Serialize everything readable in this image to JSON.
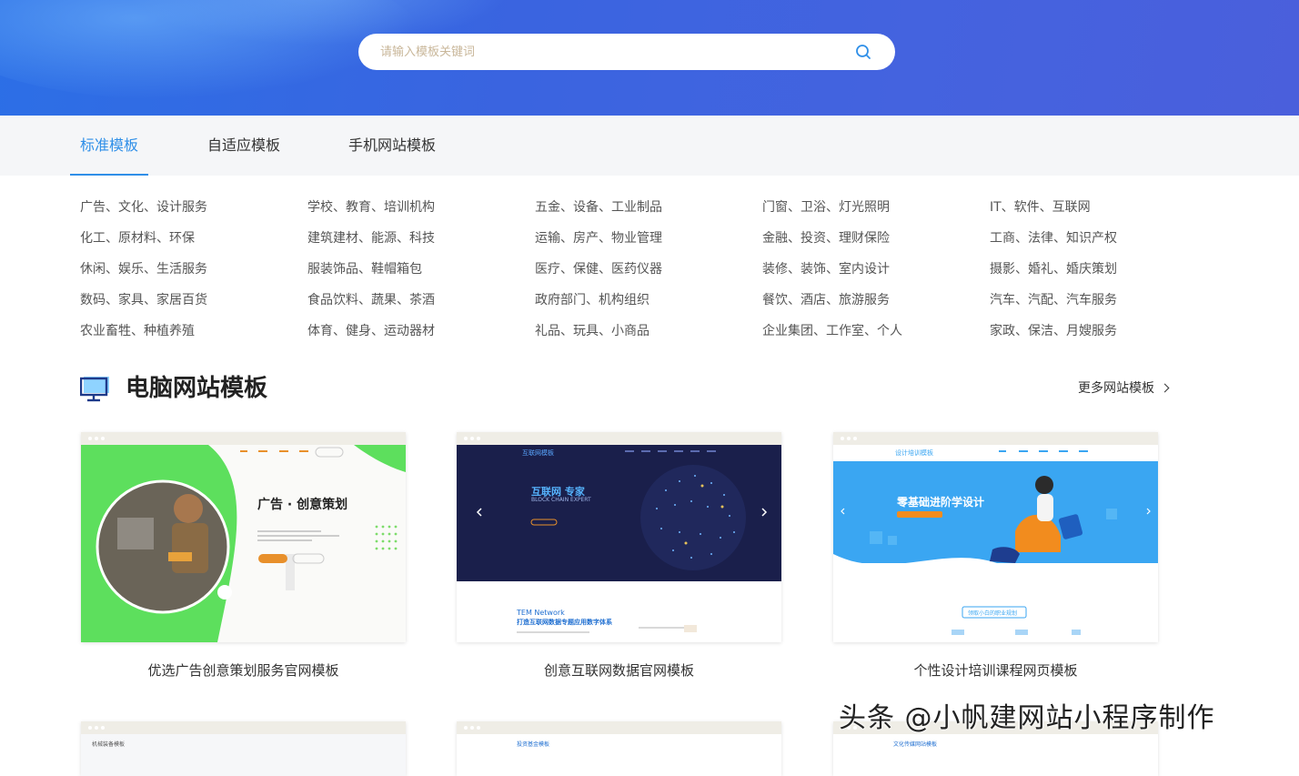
{
  "search": {
    "placeholder": "请输入模板关键词"
  },
  "tabs": [
    {
      "label": "标准模板",
      "active": true
    },
    {
      "label": "自适应模板",
      "active": false
    },
    {
      "label": "手机网站模板",
      "active": false
    }
  ],
  "categories": [
    [
      "广告、文化、设计服务",
      "学校、教育、培训机构",
      "五金、设备、工业制品",
      "门窗、卫浴、灯光照明",
      "IT、软件、互联网"
    ],
    [
      "化工、原材料、环保",
      "建筑建材、能源、科技",
      "运输、房产、物业管理",
      "金融、投资、理财保险",
      "工商、法律、知识产权"
    ],
    [
      "休闲、娱乐、生活服务",
      "服装饰品、鞋帽箱包",
      "医疗、保健、医药仪器",
      "装修、装饰、室内设计",
      "摄影、婚礼、婚庆策划"
    ],
    [
      "数码、家具、家居百货",
      "食品饮料、蔬果、茶酒",
      "政府部门、机构组织",
      "餐饮、酒店、旅游服务",
      "汽车、汽配、汽车服务"
    ],
    [
      "农业畜牲、种植养殖",
      "体育、健身、运动器材",
      "礼品、玩具、小商品",
      "企业集团、工作室、个人",
      "家政、保洁、月嫂服务"
    ]
  ],
  "section": {
    "title": "电脑网站模板",
    "more_label": "更多网站模板"
  },
  "templates": [
    {
      "caption": "优选广告创意策划服务官网模板",
      "preview": {
        "headline": "广告 · 创意策划",
        "accent": "#5ddf5d",
        "button": "#e8902b"
      }
    },
    {
      "caption": "创意互联网数据官网模板",
      "preview": {
        "logo": "互联网模板",
        "headline": "互联网 专家",
        "subline": "BLOCK CHAIN EXPERT",
        "footer_title": "TEM Network",
        "footer_sub": "打造互联网数据专题应用数字体系",
        "bg": "#1a1f4b"
      }
    },
    {
      "caption": "个性设计培训课程网页模板",
      "preview": {
        "logo": "设计培训模板",
        "headline": "零基础进阶学设计",
        "cta": "领取小白的职业规划",
        "bg": "#3aa6f2"
      }
    }
  ],
  "partial_cards": [
    {
      "logo": "机械装备模板"
    },
    {
      "logo": "投资基金模板"
    },
    {
      "logo": "文化传媒网站模板"
    }
  ],
  "watermark": "头条 @小帆建网站小程序制作"
}
